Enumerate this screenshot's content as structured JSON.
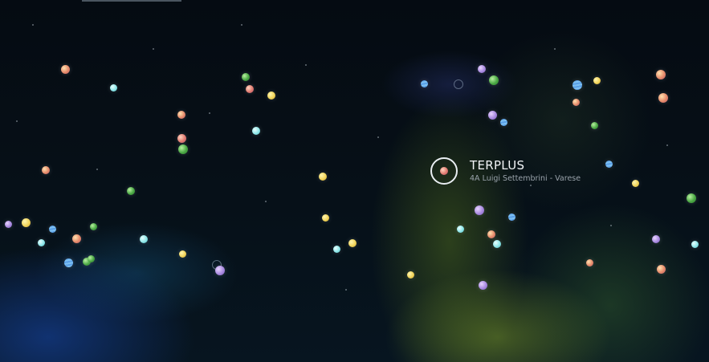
{
  "selected_location": {
    "name": "TERPLUS",
    "address": "4A Luigi Settembrini - Varese"
  },
  "planet_colors": {
    "peach": "#e68a6a",
    "pink": "#e07a70",
    "yellow": "#f1d45a",
    "green": "#4aa844",
    "cyan": "#8ee6e8",
    "purple": "#a98ae0",
    "blue": "#5aa0e8"
  }
}
